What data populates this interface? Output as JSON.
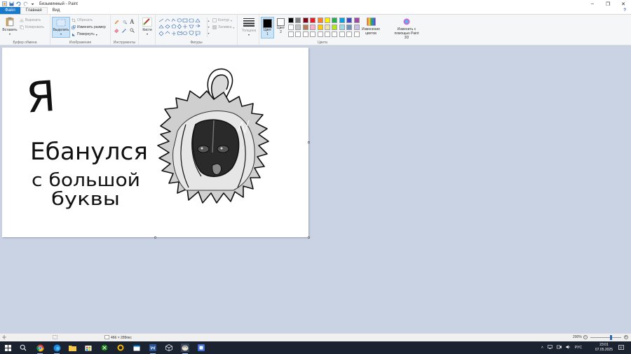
{
  "window": {
    "title": "Безымянный - Paint",
    "controls": {
      "minimize": "–",
      "maximize": "❐",
      "close": "✕"
    },
    "help_icon": "?"
  },
  "tabs": [
    {
      "label": "Файл"
    },
    {
      "label": "Главная"
    },
    {
      "label": "Вид"
    }
  ],
  "ribbon": {
    "clipboard": {
      "label": "Буфер обмена",
      "paste": "Вставить",
      "cut": "Вырезать",
      "copy": "Копировать"
    },
    "image": {
      "label": "Изображение",
      "select": "Выделить",
      "crop": "Обрезать",
      "resize": "Изменить размер",
      "rotate": "Повернуть"
    },
    "tools": {
      "label": "Инструменты"
    },
    "brushes": {
      "label": "Кисти"
    },
    "shapes": {
      "label": "Фигуры",
      "outline": "Контур",
      "fill": "Заливка"
    },
    "size": {
      "label": "Толщина"
    },
    "colors": {
      "label": "Цвета",
      "color1": "Цвет 1",
      "color2": "Цвет 2",
      "edit_colors": "Изменение цветов",
      "paint3d": "Изменить с помощью Paint 3D",
      "color1_value": "#000000",
      "color2_value": "#ffffff",
      "palette_row1": [
        "#000000",
        "#7f7f7f",
        "#880015",
        "#ed1c24",
        "#ff7f27",
        "#fff200",
        "#22b14c",
        "#00a2e8",
        "#3f48cc",
        "#a349a4"
      ],
      "palette_row2": [
        "#ffffff",
        "#c3c3c3",
        "#b97a57",
        "#ffaec9",
        "#ffc90e",
        "#efe4b0",
        "#b5e61d",
        "#99d9ea",
        "#7092be",
        "#c8bfe7"
      ]
    }
  },
  "canvas": {
    "handwriting": {
      "line1": "Я",
      "line2": "Ебанулся",
      "line3": "с большой",
      "line4": "буквы"
    }
  },
  "statusbar": {
    "dimensions": "466 × 289пкс",
    "zoom": "200%"
  },
  "tray": {
    "language": "РУС",
    "time": "23:01",
    "date": "07.05.2025"
  }
}
